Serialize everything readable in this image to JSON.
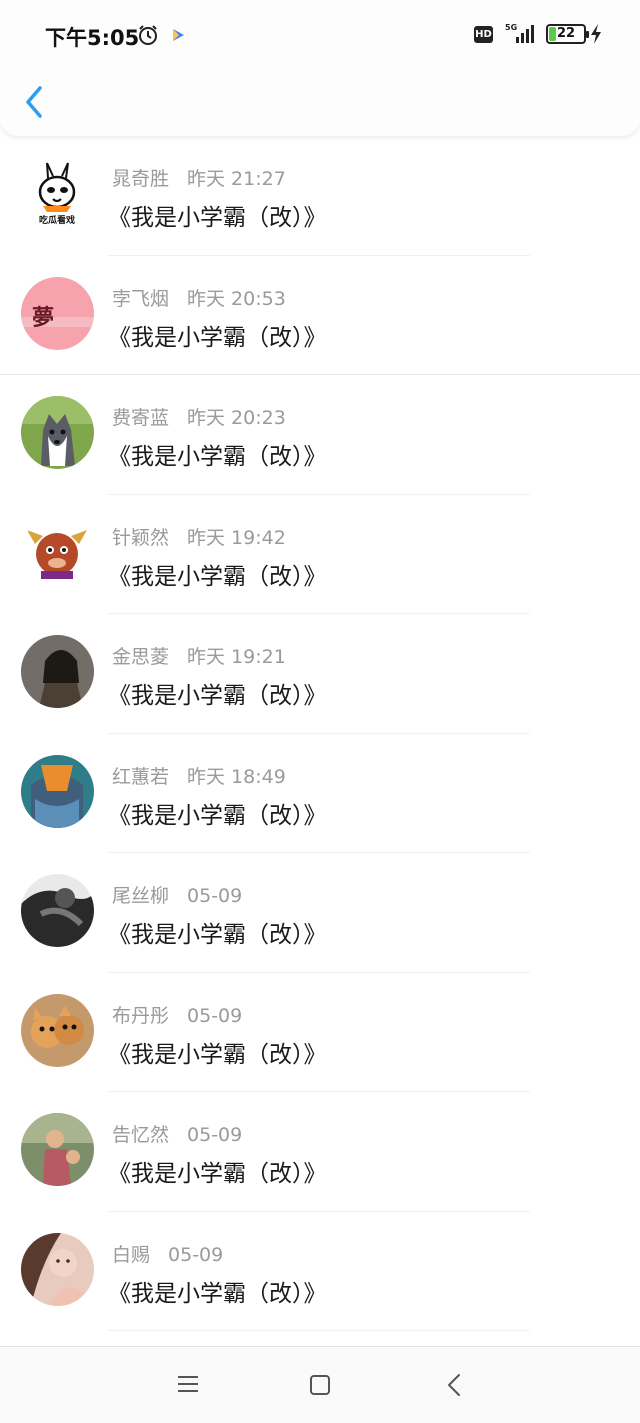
{
  "status_bar": {
    "time": "下午5:05",
    "network": "5G",
    "hd": "HD",
    "battery_level": "22",
    "battery_fraction": 0.22
  },
  "header": {
    "back_icon": "chevron-left-icon"
  },
  "items": [
    {
      "name": "晁奇胜",
      "time": "昨天 21:27",
      "title": "《我是小学霸（改）》",
      "avatar_text": "吃瓜看戏"
    },
    {
      "name": "孛飞烟",
      "time": "昨天 20:53",
      "title": "《我是小学霸（改）》",
      "avatar_text": "夢"
    },
    {
      "name": "费寄蓝",
      "time": "昨天 20:23",
      "title": "《我是小学霸（改）》"
    },
    {
      "name": "针颖然",
      "time": "昨天 19:42",
      "title": "《我是小学霸（改）》"
    },
    {
      "name": "金思菱",
      "time": "昨天 19:21",
      "title": "《我是小学霸（改）》"
    },
    {
      "name": "红蕙若",
      "time": "昨天 18:49",
      "title": "《我是小学霸（改）》"
    },
    {
      "name": "尾丝柳",
      "time": "05-09",
      "title": "《我是小学霸（改）》"
    },
    {
      "name": "布丹彤",
      "time": "05-09",
      "title": "《我是小学霸（改）》"
    },
    {
      "name": "告忆然",
      "time": "05-09",
      "title": "《我是小学霸（改）》"
    },
    {
      "name": "白赐",
      "time": "05-09",
      "title": "《我是小学霸（改）》"
    }
  ],
  "nav_bar": {
    "menu_icon": "menu-icon",
    "home_icon": "home-square-icon",
    "back_icon": "back-triangle-icon"
  },
  "colors": {
    "accent": "#2b9ef0",
    "meta_text": "#9a9a9a",
    "title_text": "#1a1a1a",
    "battery": "#5cc94b"
  }
}
